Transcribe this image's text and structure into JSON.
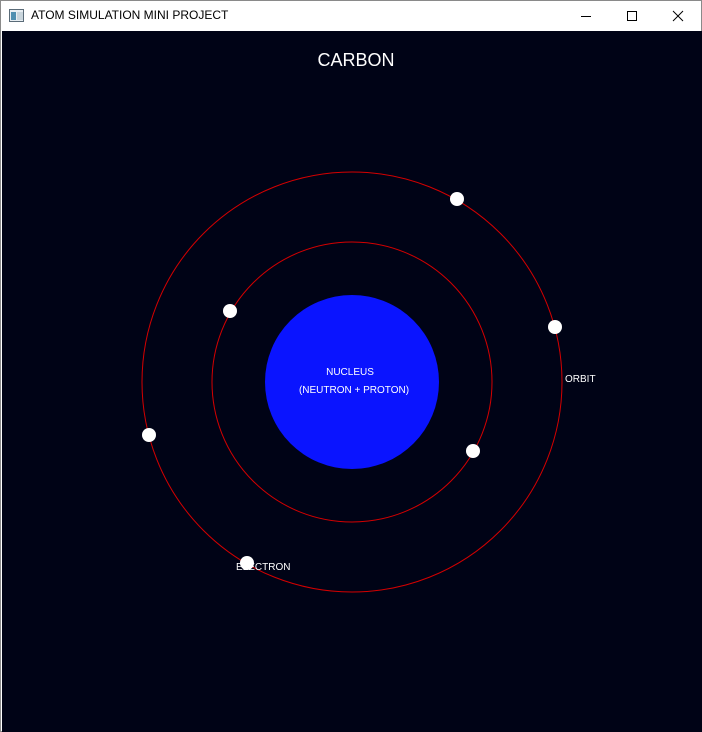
{
  "window": {
    "title": "ATOM SIMULATION MINI PROJECT",
    "controls": [
      "minimize",
      "maximize",
      "close"
    ]
  },
  "scene": {
    "element_name": "CARBON",
    "nucleus_label": "NUCLEUS",
    "nucleus_sublabel": "(NEUTRON + PROTON)",
    "orbit_label": "ORBIT",
    "electron_label": "ELECTRON",
    "electron_count": 6,
    "colors": {
      "background": "#000316",
      "nucleus": "#0a14ff",
      "orbit": "#d40000",
      "electron": "#ffffff",
      "text": "#ffffff"
    }
  }
}
